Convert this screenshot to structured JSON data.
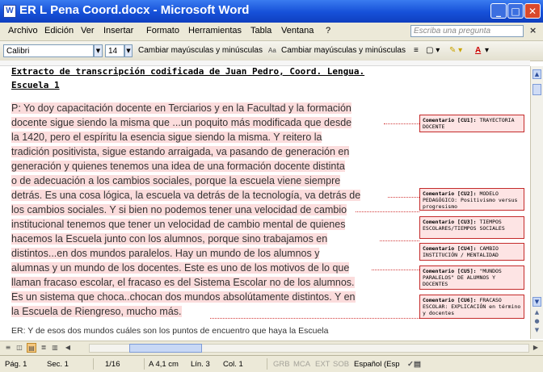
{
  "window": {
    "title": "ER L Pena Coord.docx - Microsoft Word",
    "app_icon": "word-document-icon",
    "controls": [
      "minimize-icon",
      "maximize-icon",
      "close-icon"
    ]
  },
  "menu": {
    "items": [
      "Archivo",
      "Edición",
      "Ver",
      "Insertar",
      "Formato",
      "Herramientas",
      "Tabla",
      "Ventana",
      "?"
    ],
    "help_placeholder": "Escriba una pregunta",
    "close": "×"
  },
  "toolbar": {
    "font": "Calibri",
    "size": "14",
    "change_case_1": "Cambiar mayúsculas y minúsculas",
    "change_case_2": "Cambiar mayúsculas y minúsculas",
    "icons": [
      "change-case-icon",
      "align-justify-icon",
      "border-icon",
      "highlight-icon",
      "font-color-icon"
    ]
  },
  "document": {
    "heading_line1": "Extracto de transcripción codificada de Juan Pedro, Coord. Lengua.",
    "heading_line2": "Escuela 1",
    "lines": [
      "P: Yo doy capacitación docente en Terciarios y en la Facultad y la formación",
      "docente sigue siendo la misma que ...un poquito más modificada que desde",
      "la 1420, pero el espíritu la esencia sigue siendo la misma. Y reitero la",
      "tradición positivista, sigue estando arraigada, va pasando de generación en",
      "generación y quienes tenemos una idea de una formación docente distinta",
      "o de  adecuación a los cambios sociales, porque la escuela viene siempre",
      "detrás. Es una cosa lógica, la escuela va detrás de la tecnología, va detrás de",
      "los cambios sociales. Y si bien no podemos tener una velocidad de cambio",
      "institucional tenemos que tener un velocidad de cambio mental de quienes",
      "hacemos la Escuela junto con los alumnos, porque sino trabajamos en",
      "distintos...en dos mundos paralelos. Hay un mundo de los alumnos y",
      "alumnas y un mundo de los docentes. Este es uno de los motivos de lo que",
      "llaman fracaso escolar,  el fracaso es del Sistema Escolar no de los alumnos.",
      "Es un sistema que choca..chocan dos mundos absolútamente distintos. Y en",
      "la Escuela de Riengreso, mucho más."
    ],
    "last_line": "ER: Y de esos dos mundos cuáles son los puntos de encuentro que haya la Escuela"
  },
  "comments": [
    {
      "label": "Comentario [CU1]:",
      "text": "TRAYECTORIA DOCENTE"
    },
    {
      "label": "Comentario [CU2]:",
      "text": "MODELO PEDAGÓGICO: Positivismo versus progresismo"
    },
    {
      "label": "Comentario [CU3]:",
      "text": "TIEMPOS ESCOLARES/TIEMPOS SOCIALES"
    },
    {
      "label": "Comentario [CU4]:",
      "text": "CAMBIO INSTITUCIÓN / MENTALIDAD"
    },
    {
      "label": "Comentario [CU5]:",
      "text": "\"MUNDOS PARALELOS\" DE ALUMNOS Y DOCENTES"
    },
    {
      "label": "Comentario [CU6]:",
      "text": "FRACASO ESCOLAR: EXPLICACIÓN en término y docentes"
    }
  ],
  "status": {
    "page": "Pág. 1",
    "section": "Sec. 1",
    "pages": "1/16",
    "at": "A 4,1 cm",
    "line": "Lín. 3",
    "col": "Col. 1",
    "grb": "GRB",
    "mca": "MCA",
    "ext": "EXT",
    "sob": "SOB",
    "language": "Español (Esp"
  }
}
